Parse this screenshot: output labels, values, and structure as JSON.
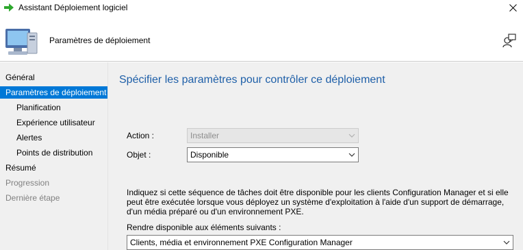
{
  "window": {
    "title": "Assistant Déploiement logiciel",
    "icons": {
      "title": "green-arrow-icon",
      "close": "close-icon"
    }
  },
  "header": {
    "title": "Paramètres de déploiement",
    "icons": {
      "wizard": "computer-icon",
      "help": "user-help-icon"
    }
  },
  "sidebar": {
    "items": [
      {
        "label": "Général",
        "state": "normal"
      },
      {
        "label": "Paramètres de déploiement",
        "state": "selected"
      },
      {
        "label": "Planification",
        "state": "normal"
      },
      {
        "label": "Expérience utilisateur",
        "state": "normal"
      },
      {
        "label": "Alertes",
        "state": "normal"
      },
      {
        "label": "Points de distribution",
        "state": "normal"
      },
      {
        "label": "Résumé",
        "state": "normal"
      },
      {
        "label": "Progression",
        "state": "disabled"
      },
      {
        "label": "Dernière étape",
        "state": "disabled"
      }
    ]
  },
  "main": {
    "heading": "Spécifier les paramètres pour contrôler ce déploiement",
    "action": {
      "label": "Action :",
      "value": "Installer",
      "enabled": false
    },
    "purpose": {
      "label": "Objet :",
      "value": "Disponible",
      "enabled": true
    },
    "description": "Indiquez si cette séquence de tâches doit être disponible pour les clients Configuration Manager et si elle peut être exécutée lorsque vous déployez un système d'exploitation à l'aide d'un support de démarrage, d'un média préparé ou d'un environnement PXE.",
    "availability": {
      "label": "Rendre disponible aux éléments suivants :",
      "value": "Clients, média et environnement PXE Configuration Manager"
    }
  },
  "colors": {
    "accent": "#0078d7",
    "heading": "#1e5fa8",
    "panel": "#f0f0f0",
    "disabled_text": "#808080"
  }
}
